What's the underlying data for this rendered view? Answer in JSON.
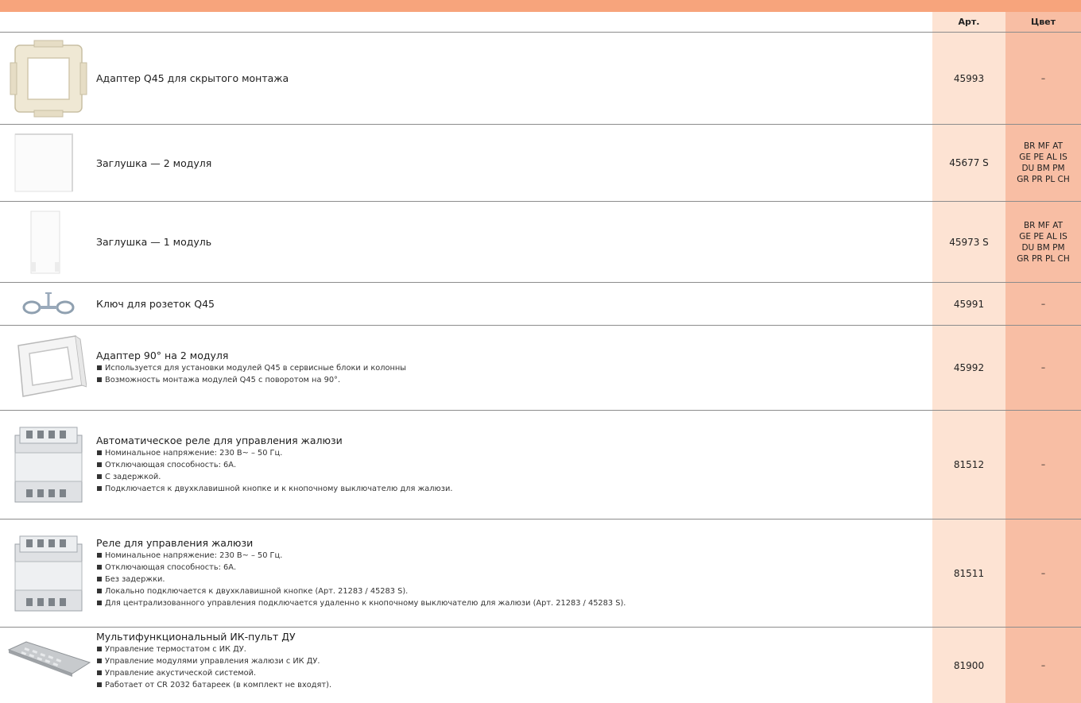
{
  "header": {
    "art_label": "Арт.",
    "color_label": "Цвет"
  },
  "rows": [
    {
      "title": "Адаптер Q45 для скрытого монтажа",
      "bullets": [],
      "art": "45993",
      "color": [
        "–"
      ]
    },
    {
      "title": "Заглушка — 2 модуля",
      "bullets": [],
      "art": "45677 S",
      "color": [
        "BR MF AT",
        "GE PE AL IS",
        "DU BM PM",
        "GR PR PL CH"
      ]
    },
    {
      "title": "Заглушка — 1 модуль",
      "bullets": [],
      "art": "45973 S",
      "color": [
        "BR MF AT",
        "GE PE AL IS",
        "DU BM PM",
        "GR PR PL CH"
      ]
    },
    {
      "title": "Ключ для розеток Q45",
      "bullets": [],
      "art": "45991",
      "color": [
        "–"
      ]
    },
    {
      "title": "Адаптер 90° на 2 модуля",
      "bullets": [
        "Используется для установки модулей Q45 в сервисные блоки и колонны",
        "Возможность монтажа модулей Q45 с поворотом на 90°."
      ],
      "art": "45992",
      "color": [
        "–"
      ]
    },
    {
      "title": "Автоматическое реле для управления жалюзи",
      "bullets": [
        "Номинальное напряжение: 230 В~ – 50 Гц.",
        "Отключающая способность: 6А.",
        "С задержкой.",
        "Подключается к двухклавишной кнопке и к кнопочному выключателю для жалюзи."
      ],
      "art": "81512",
      "color": [
        "–"
      ]
    },
    {
      "title": "Реле для управления жалюзи",
      "bullets": [
        "Номинальное напряжение: 230 В~ – 50 Гц.",
        "Отключающая способность: 6А.",
        "Без задержки.",
        "Локально подключается к двухклавишной кнопке (Арт. 21283 / 45283 S).",
        "Для централизованного управления подключается удаленно к кнопочному выключателю для жалюзи (Арт. 21283 / 45283 S)."
      ],
      "art": "81511",
      "color": [
        "–"
      ]
    },
    {
      "title": "Мультифункциональный ИК-пульт ДУ",
      "bullets": [
        "Управление термостатом с ИК ДУ.",
        "Управление модулями управления жалюзи с ИК ДУ.",
        "Управление акустической системой.",
        "Работает от CR 2032 батареек (в комплект не входят)."
      ],
      "art": "81900",
      "color": [
        "–"
      ]
    }
  ],
  "icons": [
    "adapter-frame-image",
    "blank-plate-2-module-image",
    "blank-plate-1-module-image",
    "socket-key-image",
    "adapter-90-image",
    "relay-image",
    "relay-image",
    "remote-control-image"
  ]
}
